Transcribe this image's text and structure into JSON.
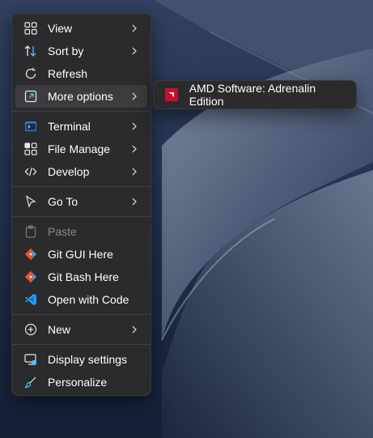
{
  "context_menu": {
    "items": [
      {
        "label": "View",
        "icon": "view-grid-icon",
        "has_submenu": true
      },
      {
        "label": "Sort by",
        "icon": "sort-icon",
        "has_submenu": true
      },
      {
        "label": "Refresh",
        "icon": "refresh-icon",
        "has_submenu": false
      },
      {
        "label": "More options",
        "icon": "more-options-icon",
        "has_submenu": true
      },
      {
        "label": "Terminal",
        "icon": "terminal-icon",
        "has_submenu": true
      },
      {
        "label": "File Manage",
        "icon": "file-manage-icon",
        "has_submenu": true
      },
      {
        "label": "Develop",
        "icon": "code-icon",
        "has_submenu": true
      },
      {
        "label": "Go To",
        "icon": "cursor-icon",
        "has_submenu": true
      },
      {
        "label": "Paste",
        "icon": "paste-icon",
        "has_submenu": false
      },
      {
        "label": "Git GUI Here",
        "icon": "git-icon",
        "has_submenu": false
      },
      {
        "label": "Git Bash Here",
        "icon": "git-icon",
        "has_submenu": false
      },
      {
        "label": "Open with Code",
        "icon": "vscode-icon",
        "has_submenu": false
      },
      {
        "label": "New",
        "icon": "plus-circle-icon",
        "has_submenu": true
      },
      {
        "label": "Display settings",
        "icon": "display-settings-icon",
        "has_submenu": false
      },
      {
        "label": "Personalize",
        "icon": "brush-icon",
        "has_submenu": false
      }
    ]
  },
  "submenu": {
    "items": [
      {
        "label": "AMD Software: Adrenalin Edition",
        "icon": "amd-icon"
      }
    ]
  },
  "colors": {
    "menu_bg": "#2b2b2d",
    "hover_bg": "#3c3c3f",
    "accent": "#4cc2ff",
    "amd_red": "#c8102e"
  }
}
